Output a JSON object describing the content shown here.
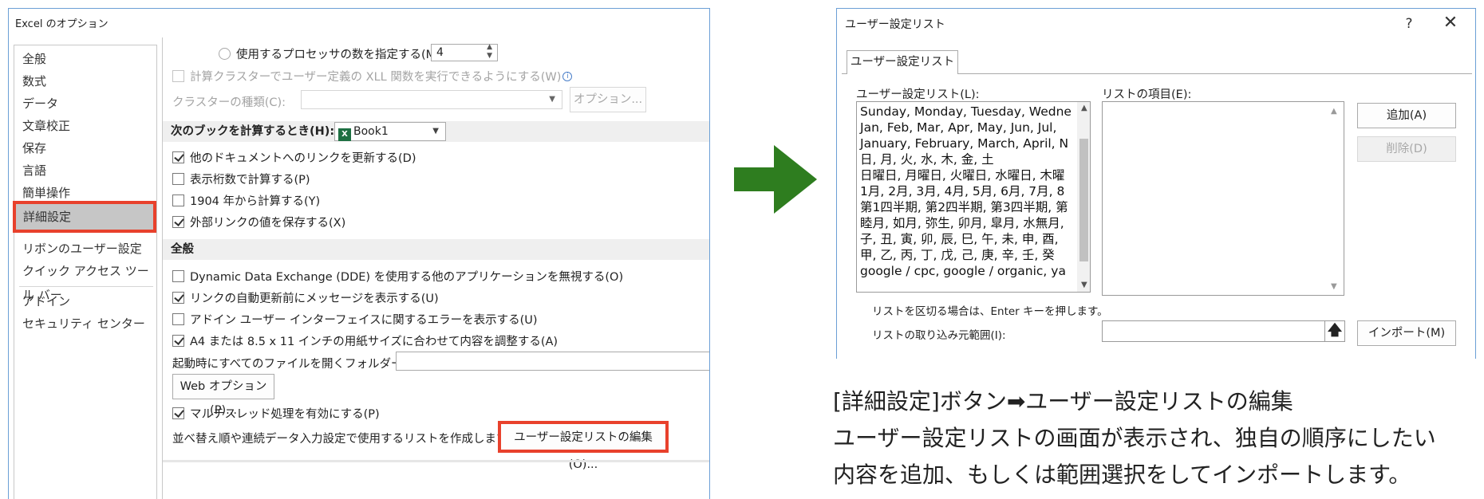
{
  "excel_dialog": {
    "title": "Excel のオプション",
    "nav_items": [
      "全般",
      "数式",
      "データ",
      "文章校正",
      "保存",
      "言語",
      "簡単操作",
      "詳細設定",
      "リボンのユーザー設定",
      "クイック アクセス ツール バー",
      "アドイン",
      "セキュリティ センター"
    ],
    "processors_label": "使用するプロセッサの数を指定する(M):",
    "processors_value": "4",
    "cluster_xll_label": "計算クラスターでユーザー定義の XLL 関数を実行できるようにする(W)",
    "cluster_type_label": "クラスターの種類(C):",
    "cluster_options_button": "オプション...",
    "calc_section_label": "次のブックを計算するとき(H):",
    "calc_book": "Book1",
    "calc_options": [
      {
        "label": "他のドキュメントへのリンクを更新する(D)",
        "checked": true
      },
      {
        "label": "表示桁数で計算する(P)",
        "checked": false
      },
      {
        "label": "1904 年から計算する(Y)",
        "checked": false
      },
      {
        "label": "外部リンクの値を保存する(X)",
        "checked": true
      }
    ],
    "general_section": "全般",
    "general_options": [
      {
        "label": "Dynamic Data Exchange (DDE) を使用する他のアプリケーションを無視する(O)",
        "checked": false
      },
      {
        "label": "リンクの自動更新前にメッセージを表示する(U)",
        "checked": true
      },
      {
        "label": "アドイン ユーザー インターフェイスに関するエラーを表示する(U)",
        "checked": false
      },
      {
        "label": "A4 または 8.5 x 11 インチの用紙サイズに合わせて内容を調整する(A)",
        "checked": true
      }
    ],
    "startup_folder_label": "起動時にすべてのファイルを開くフォルダー(L):",
    "web_options_button": "Web オプション(P)...",
    "multithread_label": "マルチスレッド処理を有効にする(P)",
    "multithread_checked": true,
    "custom_list_text": "並べ替え順や連続データ入力設定で使用するリストを作成します:",
    "edit_custom_lists_button": "ユーザー設定リストの編集(O)..."
  },
  "custom_list_dialog": {
    "title": "ユーザー設定リスト",
    "help": "?",
    "close": "✕",
    "tab": "ユーザー設定リスト",
    "lists_label": "ユーザー設定リスト(L):",
    "entries_label": "リストの項目(E):",
    "lists": [
      "Sunday, Monday, Tuesday, Wedne",
      "Jan, Feb, Mar, Apr, May, Jun, Jul,",
      "January, February, March, April, N",
      "日, 月, 火, 水, 木, 金, 土",
      "日曜日, 月曜日, 火曜日, 水曜日, 木曜",
      "1月, 2月, 3月, 4月, 5月, 6月, 7月, 8",
      "第1四半期, 第2四半期, 第3四半期, 第",
      "睦月, 如月, 弥生, 卯月, 皐月, 水無月,",
      "子, 丑, 寅, 卯, 辰, 巳, 午, 未, 申, 酉,",
      "甲, 乙, 丙, 丁, 戊, 己, 庚, 辛, 壬, 癸",
      "google / cpc, google / organic, ya"
    ],
    "add_button": "追加(A)",
    "delete_button": "削除(D)",
    "separator_hint": "リストを区切る場合は、Enter キーを押します。",
    "import_range_label": "リストの取り込み元範囲(I):",
    "import_button": "インポート(M)"
  },
  "caption": {
    "line1": "[詳細設定]ボタン➡ユーザー設定リストの編集",
    "line2": "ユーザー設定リストの画面が表示され、独自の順序にしたい",
    "line3": "内容を追加、もしくは範囲選択をしてインポートします。"
  },
  "colors": {
    "highlight": "#e8412c",
    "arrow": "#2e7d1f",
    "excel_green": "#1d6f42"
  }
}
